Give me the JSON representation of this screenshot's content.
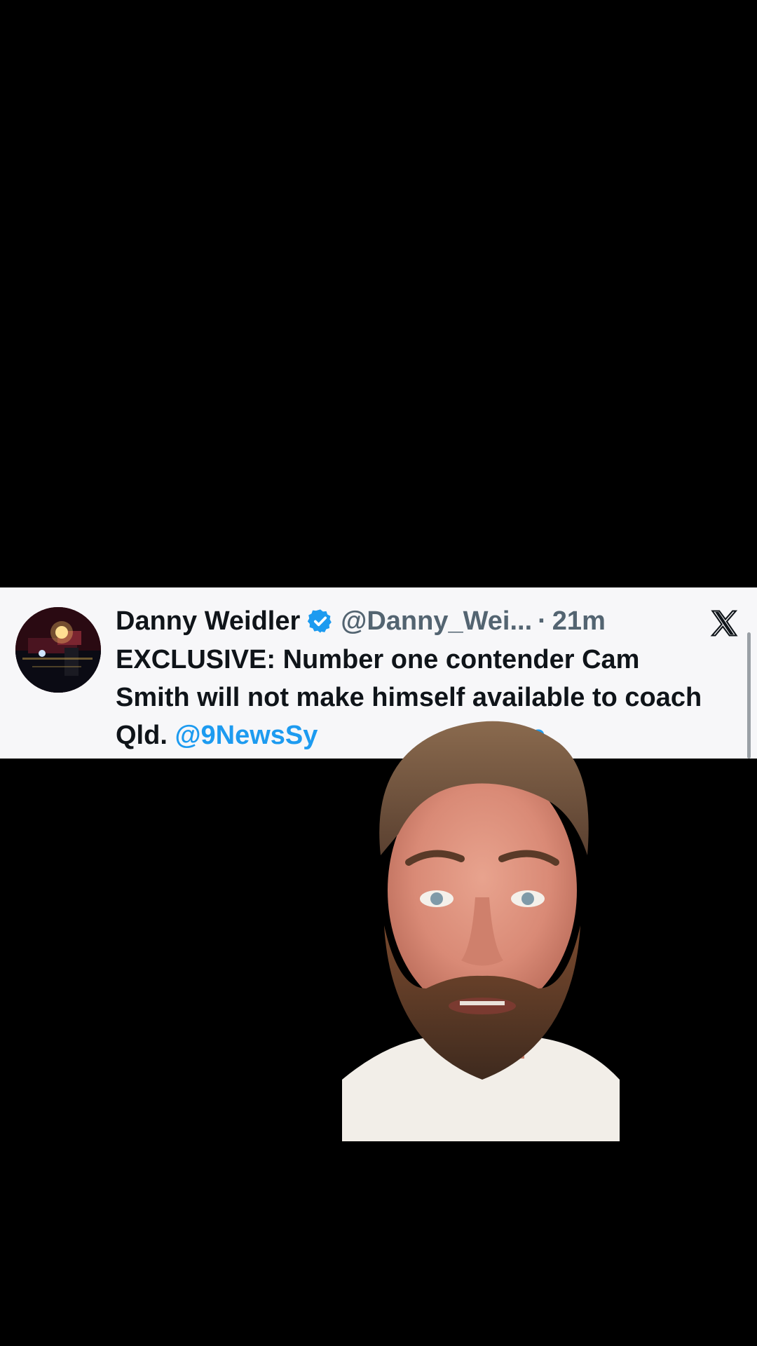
{
  "tweet": {
    "display_name": "Danny Weidler",
    "handle": "@Danny_Wei...",
    "separator": "·",
    "time": "21m",
    "text_main": "EXCLUSIVE: Number one contender Cam Smith will not make himself available to coach Qld. ",
    "mention_visible": "@9NewsSy",
    "mention_tail": "onNine",
    "verified_color": "#1d9bf0"
  },
  "icons": {
    "close": "x-logo-icon",
    "verified": "verified-badge-icon"
  },
  "colors": {
    "background": "#000000",
    "card_background": "#f7f7f9",
    "mention": "#1d9bf0",
    "text": "#0f1419",
    "muted": "#536471"
  }
}
